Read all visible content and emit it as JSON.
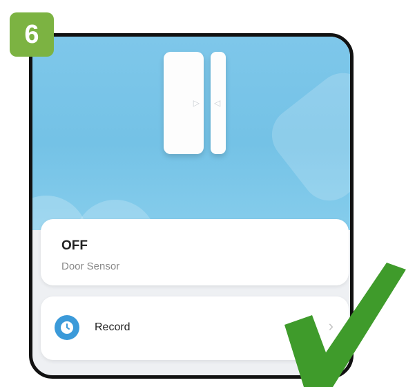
{
  "step": {
    "number": "6"
  },
  "device": {
    "status": "OFF",
    "name": "Door Sensor"
  },
  "record": {
    "label": "Record",
    "chevron": "›"
  },
  "icons": {
    "clock": "clock-icon",
    "chevron": "chevron-right-icon",
    "check": "checkmark-icon"
  },
  "colors": {
    "badge": "#7cb342",
    "hero_blue": "#74c2e6",
    "clock_blue": "#3b9ad9",
    "check_green": "#3f9b2b"
  }
}
